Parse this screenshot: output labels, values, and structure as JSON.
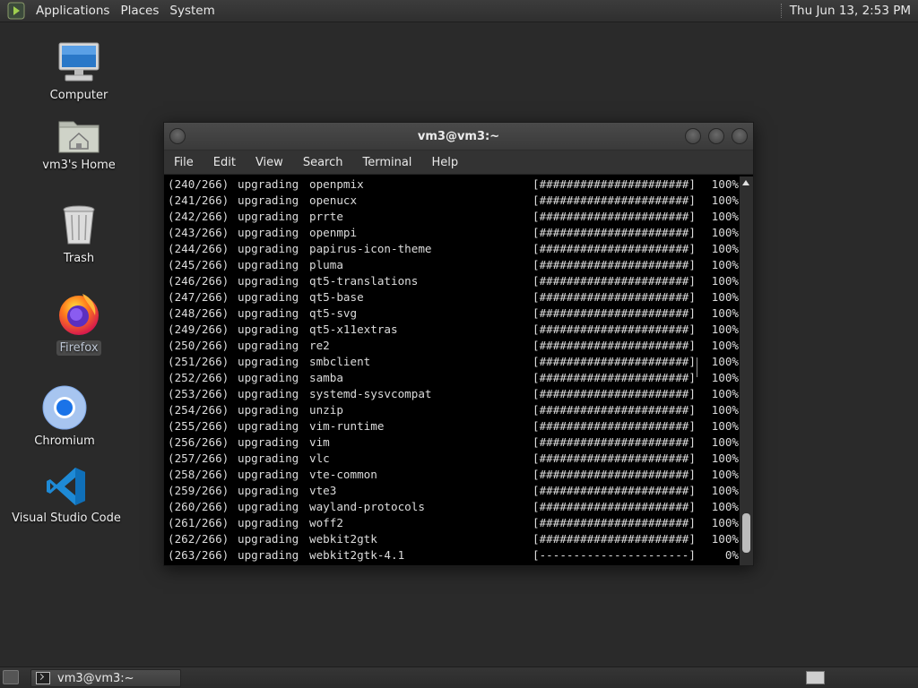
{
  "top_panel": {
    "menus": [
      "Applications",
      "Places",
      "System"
    ],
    "clock": "Thu Jun 13,  2:53 PM"
  },
  "desktop_icons": [
    {
      "label": "Computer",
      "icon": "computer-icon"
    },
    {
      "label": "vm3's Home",
      "icon": "home-folder-icon"
    },
    {
      "label": "Trash",
      "icon": "trash-icon"
    },
    {
      "label": "Firefox",
      "icon": "firefox-icon",
      "selected": true
    },
    {
      "label": "Chromium",
      "icon": "chromium-icon"
    },
    {
      "label": "Visual Studio Code",
      "icon": "vscode-icon"
    }
  ],
  "terminal": {
    "title": "vm3@vm3:~",
    "menus": [
      "File",
      "Edit",
      "View",
      "Search",
      "Terminal",
      "Help"
    ],
    "lines": [
      {
        "idx": "(240/266)",
        "action": "upgrading",
        "pkg": "openpmix",
        "bar": "[######################]",
        "pct": "100%"
      },
      {
        "idx": "(241/266)",
        "action": "upgrading",
        "pkg": "openucx",
        "bar": "[######################]",
        "pct": "100%"
      },
      {
        "idx": "(242/266)",
        "action": "upgrading",
        "pkg": "prrte",
        "bar": "[######################]",
        "pct": "100%"
      },
      {
        "idx": "(243/266)",
        "action": "upgrading",
        "pkg": "openmpi",
        "bar": "[######################]",
        "pct": "100%"
      },
      {
        "idx": "(244/266)",
        "action": "upgrading",
        "pkg": "papirus-icon-theme",
        "bar": "[######################]",
        "pct": "100%"
      },
      {
        "idx": "(245/266)",
        "action": "upgrading",
        "pkg": "pluma",
        "bar": "[######################]",
        "pct": "100%"
      },
      {
        "idx": "(246/266)",
        "action": "upgrading",
        "pkg": "qt5-translations",
        "bar": "[######################]",
        "pct": "100%"
      },
      {
        "idx": "(247/266)",
        "action": "upgrading",
        "pkg": "qt5-base",
        "bar": "[######################]",
        "pct": "100%"
      },
      {
        "idx": "(248/266)",
        "action": "upgrading",
        "pkg": "qt5-svg",
        "bar": "[######################]",
        "pct": "100%"
      },
      {
        "idx": "(249/266)",
        "action": "upgrading",
        "pkg": "qt5-x11extras",
        "bar": "[######################]",
        "pct": "100%"
      },
      {
        "idx": "(250/266)",
        "action": "upgrading",
        "pkg": "re2",
        "bar": "[######################]",
        "pct": "100%"
      },
      {
        "idx": "(251/266)",
        "action": "upgrading",
        "pkg": "smbclient",
        "bar": "[######################]",
        "pct": "100%"
      },
      {
        "idx": "(252/266)",
        "action": "upgrading",
        "pkg": "samba",
        "bar": "[######################]",
        "pct": "100%"
      },
      {
        "idx": "(253/266)",
        "action": "upgrading",
        "pkg": "systemd-sysvcompat",
        "bar": "[######################]",
        "pct": "100%"
      },
      {
        "idx": "(254/266)",
        "action": "upgrading",
        "pkg": "unzip",
        "bar": "[######################]",
        "pct": "100%"
      },
      {
        "idx": "(255/266)",
        "action": "upgrading",
        "pkg": "vim-runtime",
        "bar": "[######################]",
        "pct": "100%"
      },
      {
        "idx": "(256/266)",
        "action": "upgrading",
        "pkg": "vim",
        "bar": "[######################]",
        "pct": "100%"
      },
      {
        "idx": "(257/266)",
        "action": "upgrading",
        "pkg": "vlc",
        "bar": "[######################]",
        "pct": "100%"
      },
      {
        "idx": "(258/266)",
        "action": "upgrading",
        "pkg": "vte-common",
        "bar": "[######################]",
        "pct": "100%"
      },
      {
        "idx": "(259/266)",
        "action": "upgrading",
        "pkg": "vte3",
        "bar": "[######################]",
        "pct": "100%"
      },
      {
        "idx": "(260/266)",
        "action": "upgrading",
        "pkg": "wayland-protocols",
        "bar": "[######################]",
        "pct": "100%"
      },
      {
        "idx": "(261/266)",
        "action": "upgrading",
        "pkg": "woff2",
        "bar": "[######################]",
        "pct": "100%"
      },
      {
        "idx": "(262/266)",
        "action": "upgrading",
        "pkg": "webkit2gtk",
        "bar": "[######################]",
        "pct": "100%"
      },
      {
        "idx": "(263/266)",
        "action": "upgrading",
        "pkg": "webkit2gtk-4.1",
        "bar": "[----------------------]",
        "pct": "0%"
      }
    ]
  },
  "taskbar": {
    "tasks": [
      {
        "label": "vm3@vm3:~",
        "icon": "terminal-icon"
      }
    ]
  }
}
